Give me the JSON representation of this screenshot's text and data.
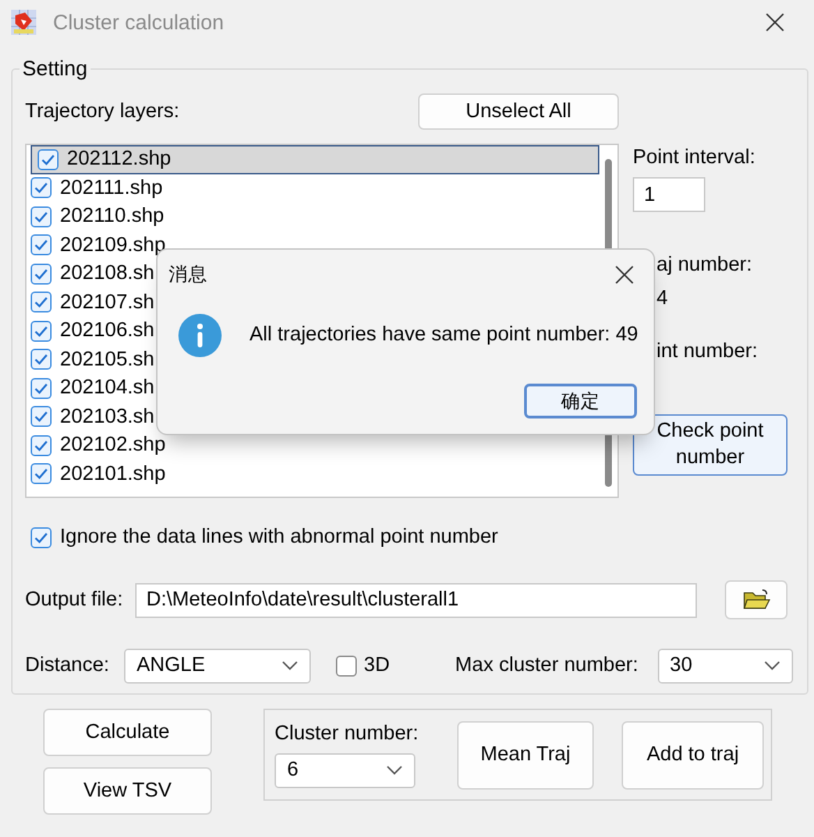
{
  "window": {
    "title": "Cluster calculation"
  },
  "setting": {
    "title": "Setting",
    "layers_label": "Trajectory layers:",
    "unselect_button": "Unselect All",
    "layers": [
      {
        "name": "202112.shp",
        "checked": true,
        "selected": true
      },
      {
        "name": "202111.shp",
        "checked": true,
        "selected": false
      },
      {
        "name": "202110.shp",
        "checked": true,
        "selected": false
      },
      {
        "name": "202109.shp",
        "checked": true,
        "selected": false
      },
      {
        "name": "202108.sh",
        "checked": true,
        "selected": false
      },
      {
        "name": "202107.sh",
        "checked": true,
        "selected": false
      },
      {
        "name": "202106.sh",
        "checked": true,
        "selected": false
      },
      {
        "name": "202105.sh",
        "checked": true,
        "selected": false
      },
      {
        "name": "202104.sh",
        "checked": true,
        "selected": false
      },
      {
        "name": "202103.sh",
        "checked": true,
        "selected": false
      },
      {
        "name": "202102.shp",
        "checked": true,
        "selected": false
      },
      {
        "name": "202101.shp",
        "checked": true,
        "selected": false
      }
    ],
    "point_interval_label": "Point interval:",
    "point_interval": "1",
    "traj_number_label": "aj number:",
    "traj_number": "4",
    "point_number_label": "int number:",
    "check_button": "Check point\nnumber",
    "ignore": {
      "label": "Ignore the data lines with abnormal point number",
      "checked": true
    },
    "output_label": "Output file:",
    "output_value": "D:\\MeteoInfo\\date\\result\\clusterall1",
    "distance_label": "Distance:",
    "distance_value": "ANGLE",
    "three_d": {
      "label": "3D",
      "checked": false
    },
    "max_label": "Max cluster number:",
    "max_value": "30"
  },
  "buttons": {
    "calculate": "Calculate",
    "view_tsv": "View TSV"
  },
  "cluster": {
    "label": "Cluster number:",
    "value": "6",
    "mean_button": "Mean Traj",
    "add_button": "Add to traj"
  },
  "dialog": {
    "title": "消息",
    "message": "All trajectories have same point number: 49",
    "ok_button": "确定"
  }
}
